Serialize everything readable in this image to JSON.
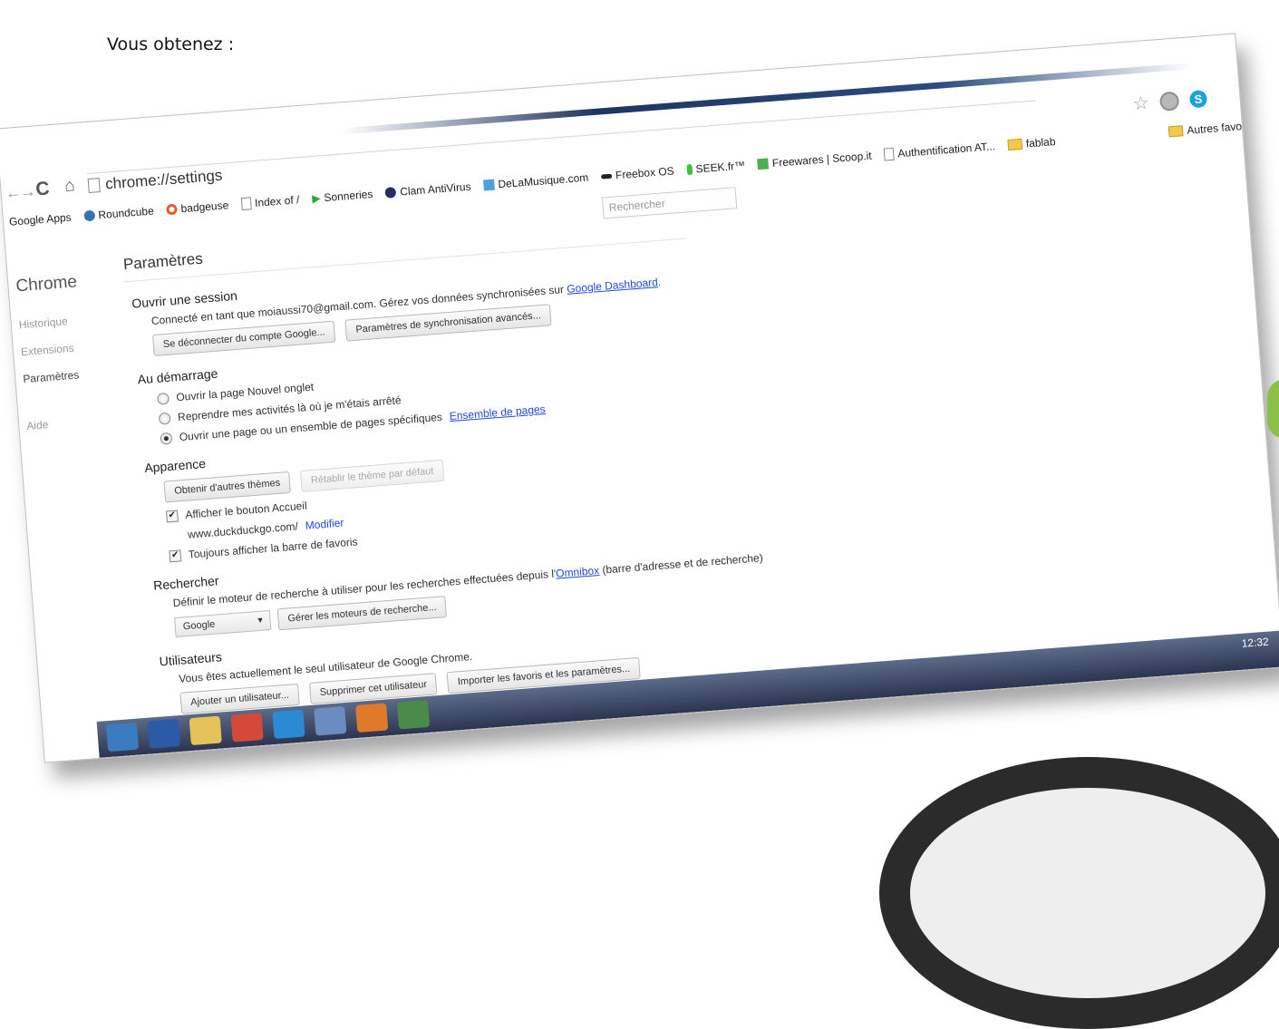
{
  "doc": {
    "heading": "Vous obtenez :"
  },
  "browser": {
    "url": "chrome://settings",
    "nav": {
      "back": "←",
      "forward": "→",
      "reload": "C",
      "home": "ñ"
    },
    "icons": {
      "star": "☆",
      "skype": "S"
    },
    "bookmarks": [
      {
        "label": "Google Apps",
        "icon": "none"
      },
      {
        "label": "Roundcube",
        "icon": "roundcube-icon"
      },
      {
        "label": "badgeuse",
        "icon": "badgeuse-icon"
      },
      {
        "label": "Index of /",
        "icon": "page-icon"
      },
      {
        "label": "Sonneries",
        "icon": "play-icon"
      },
      {
        "label": "Clam AntiVirus",
        "icon": "clamav-icon"
      },
      {
        "label": "DeLaMusique.com",
        "icon": "music-icon"
      },
      {
        "label": "Freebox OS",
        "icon": "freebox-icon"
      },
      {
        "label": "SEEK.fr™",
        "icon": "seek-icon"
      },
      {
        "label": "Freewares | Scoop.it",
        "icon": "scoopit-icon"
      },
      {
        "label": "Authentification AT...",
        "icon": "page-icon"
      },
      {
        "label": "fablab",
        "icon": "folder-icon"
      }
    ],
    "other_bookmarks": "Autres favo"
  },
  "settings": {
    "brand": "Chrome",
    "search_placeholder": "Rechercher",
    "nav": {
      "history": "Historique",
      "extensions": "Extensions",
      "settings": "Paramètres",
      "help": "Aide"
    },
    "title": "Paramètres",
    "signin": {
      "title": "Ouvrir une session",
      "text_prefix": "Connecté en tant que moiaussi70@gmail.com. Gérez vos données synchronisées sur ",
      "dashboard_link": "Google Dashboard",
      "text_suffix": ".",
      "disconnect_btn": "Se déconnecter du compte Google...",
      "sync_btn": "Paramètres de synchronisation avancés..."
    },
    "startup": {
      "title": "Au démarrage",
      "option1": "Ouvrir la page Nouvel onglet",
      "option2": "Reprendre mes activités là où je m'étais arrêté",
      "option3": "Ouvrir une page ou un ensemble de pages spécifiques",
      "pages_link": "Ensemble de pages",
      "selected": 3
    },
    "appearance": {
      "title": "Apparence",
      "themes_btn": "Obtenir d'autres thèmes",
      "reset_btn": "Rétablir le thème par défaut",
      "home_checkbox": "Afficher le bouton Accueil",
      "home_url": "www.duckduckgo.com/",
      "modify_link": "Modifier",
      "bookmarks_checkbox": "Toujours afficher la barre de favoris",
      "check_mark": "✔"
    },
    "search": {
      "title": "Rechercher",
      "text_prefix": "Définir le moteur de recherche à utiliser pour les recherches effectuées depuis l'",
      "omnibox_link": "Omnibox",
      "text_suffix": " (barre d'adresse et de recherche)",
      "engine_value": "Google",
      "engine_arrow": "▼",
      "manage_btn": "Gérer les moteurs de recherche..."
    },
    "users": {
      "title": "Utilisateurs",
      "text": "Vous êtes actuellement le seul utilisateur de Google Chrome.",
      "add_btn": "Ajouter un utilisateur...",
      "delete_btn": "Supprimer cet utilisateur",
      "import_btn": "Importer les favoris et les paramètres..."
    }
  },
  "taskbar": {
    "time": "12:32",
    "apps": [
      {
        "name": "windows",
        "color": "#3b7bbf"
      },
      {
        "name": "word",
        "color": "#2a5aa8"
      },
      {
        "name": "explorer",
        "color": "#e6c25a"
      },
      {
        "name": "chrome",
        "color": "#d44a3a"
      },
      {
        "name": "ie",
        "color": "#2a8ad4"
      },
      {
        "name": "app5",
        "color": "#6a8cc0"
      },
      {
        "name": "firefox",
        "color": "#e07a2a"
      },
      {
        "name": "app7",
        "color": "#4a8a4a"
      }
    ]
  }
}
